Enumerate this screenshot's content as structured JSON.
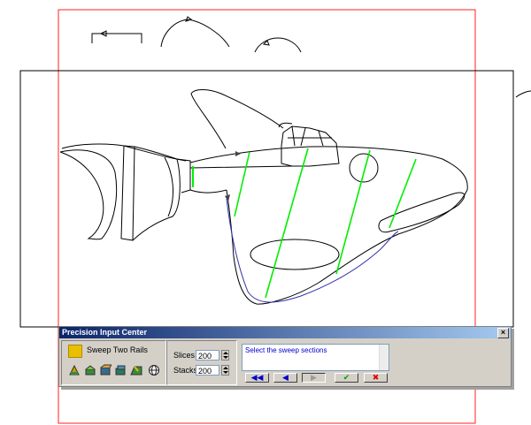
{
  "panel": {
    "title": "Precision Input Center",
    "close_glyph": "×",
    "command": {
      "icon": "sweep-icon",
      "label": "Sweep Two Rails"
    },
    "tools": [
      "sweep-mode-1-icon",
      "sweep-mode-2-icon",
      "sweep-mode-3-icon",
      "sweep-mode-4-icon",
      "sweep-mode-5-icon",
      "globe-icon"
    ],
    "params": {
      "slices_label": "Slices",
      "slices_value": "200",
      "stacks_label": "Stacks",
      "stacks_value": "200"
    },
    "prompt": "Select the sweep sections",
    "nav": {
      "first": "◀◀",
      "prev": "◀",
      "next": "▶",
      "ok": "✔",
      "cancel": "✖"
    }
  },
  "colors": {
    "viewport_border": "#ff0000",
    "rail_highlight": "#00ff00",
    "selected_curve": "#3333aa"
  }
}
